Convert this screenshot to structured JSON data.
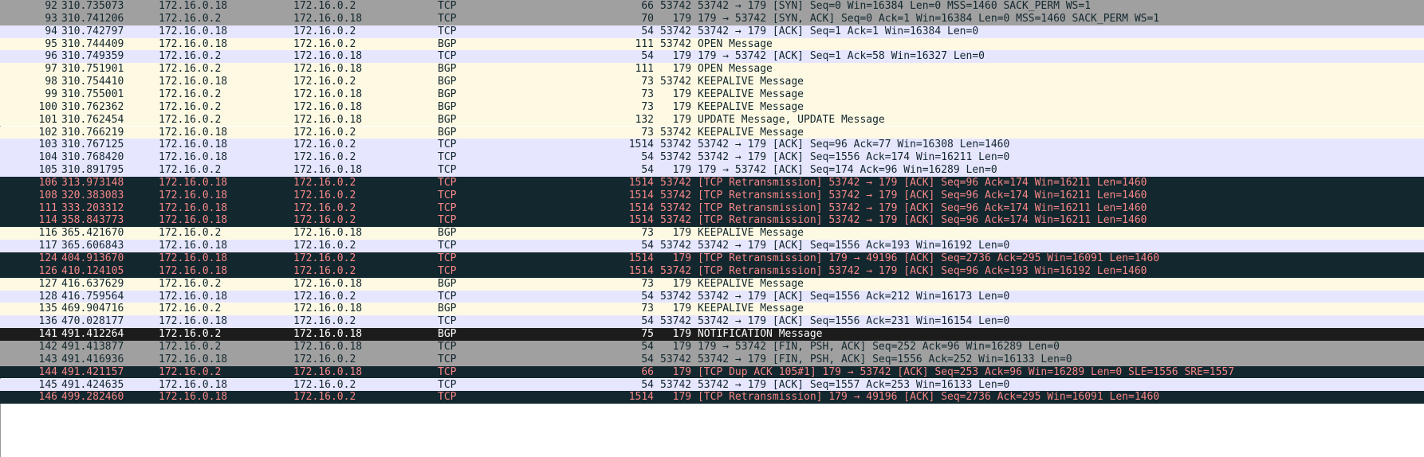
{
  "theme": {
    "tcp_bg": "#e7e6ff",
    "bgp_bg": "#fef9e3",
    "grey_bg": "#a0a0a0",
    "bad_bg": "#12272e",
    "bad_fg": "#f78787",
    "err_bg": "#1c1c1c",
    "err_fg": "#ffffff",
    "text_fg": "#12272e"
  },
  "packets": [
    {
      "no": "92",
      "time": "310.735073",
      "src": "172.16.0.18",
      "dst": "172.16.0.2",
      "proto": "TCP",
      "len": "66",
      "info": "53742 53742 → 179 [SYN] Seq=0 Win=16384 Len=0 MSS=1460 SACK_PERM WS=1",
      "style": "grey"
    },
    {
      "no": "93",
      "time": "310.741206",
      "src": "172.16.0.2",
      "dst": "172.16.0.18",
      "proto": "TCP",
      "len": "70",
      "info": "  179 179 → 53742 [SYN, ACK] Seq=0 Ack=1 Win=16384 Len=0 MSS=1460 SACK_PERM WS=1",
      "style": "grey"
    },
    {
      "no": "94",
      "time": "310.742797",
      "src": "172.16.0.18",
      "dst": "172.16.0.2",
      "proto": "TCP",
      "len": "54",
      "info": "53742 53742 → 179 [ACK] Seq=1 Ack=1 Win=16384 Len=0",
      "style": "tcp"
    },
    {
      "no": "95",
      "time": "310.744409",
      "src": "172.16.0.18",
      "dst": "172.16.0.2",
      "proto": "BGP",
      "len": "111",
      "info": "53742 OPEN Message",
      "style": "bgp"
    },
    {
      "no": "96",
      "time": "310.749359",
      "src": "172.16.0.2",
      "dst": "172.16.0.18",
      "proto": "TCP",
      "len": "54",
      "info": "  179 179 → 53742 [ACK] Seq=1 Ack=58 Win=16327 Len=0",
      "style": "tcp"
    },
    {
      "no": "97",
      "time": "310.751901",
      "src": "172.16.0.2",
      "dst": "172.16.0.18",
      "proto": "BGP",
      "len": "111",
      "info": "  179 OPEN Message",
      "style": "bgp"
    },
    {
      "no": "98",
      "time": "310.754410",
      "src": "172.16.0.18",
      "dst": "172.16.0.2",
      "proto": "BGP",
      "len": "73",
      "info": "53742 KEEPALIVE Message",
      "style": "bgp"
    },
    {
      "no": "99",
      "time": "310.755001",
      "src": "172.16.0.2",
      "dst": "172.16.0.18",
      "proto": "BGP",
      "len": "73",
      "info": "  179 KEEPALIVE Message",
      "style": "bgp"
    },
    {
      "no": "100",
      "time": "310.762362",
      "src": "172.16.0.2",
      "dst": "172.16.0.18",
      "proto": "BGP",
      "len": "73",
      "info": "  179 KEEPALIVE Message",
      "style": "bgp"
    },
    {
      "no": "101",
      "time": "310.762454",
      "src": "172.16.0.2",
      "dst": "172.16.0.18",
      "proto": "BGP",
      "len": "132",
      "info": "  179 UPDATE Message, UPDATE Message",
      "style": "bgp"
    },
    {
      "no": "102",
      "time": "310.766219",
      "src": "172.16.0.18",
      "dst": "172.16.0.2",
      "proto": "BGP",
      "len": "73",
      "info": "53742 KEEPALIVE Message",
      "style": "bgp"
    },
    {
      "no": "103",
      "time": "310.767125",
      "src": "172.16.0.18",
      "dst": "172.16.0.2",
      "proto": "TCP",
      "len": "1514",
      "info": "53742 53742 → 179 [ACK] Seq=96 Ack=77 Win=16308 Len=1460",
      "style": "tcp"
    },
    {
      "no": "104",
      "time": "310.768420",
      "src": "172.16.0.18",
      "dst": "172.16.0.2",
      "proto": "TCP",
      "len": "54",
      "info": "53742 53742 → 179 [ACK] Seq=1556 Ack=174 Win=16211 Len=0",
      "style": "tcp"
    },
    {
      "no": "105",
      "time": "310.891795",
      "src": "172.16.0.2",
      "dst": "172.16.0.18",
      "proto": "TCP",
      "len": "54",
      "info": "  179 179 → 53742 [ACK] Seq=174 Ack=96 Win=16289 Len=0",
      "style": "tcp"
    },
    {
      "no": "106",
      "time": "313.973148",
      "src": "172.16.0.18",
      "dst": "172.16.0.2",
      "proto": "TCP",
      "len": "1514",
      "info": "53742 [TCP Retransmission] 53742 → 179 [ACK] Seq=96 Ack=174 Win=16211 Len=1460",
      "style": "bad"
    },
    {
      "no": "108",
      "time": "320.383083",
      "src": "172.16.0.18",
      "dst": "172.16.0.2",
      "proto": "TCP",
      "len": "1514",
      "info": "53742 [TCP Retransmission] 53742 → 179 [ACK] Seq=96 Ack=174 Win=16211 Len=1460",
      "style": "bad"
    },
    {
      "no": "111",
      "time": "333.203312",
      "src": "172.16.0.18",
      "dst": "172.16.0.2",
      "proto": "TCP",
      "len": "1514",
      "info": "53742 [TCP Retransmission] 53742 → 179 [ACK] Seq=96 Ack=174 Win=16211 Len=1460",
      "style": "bad"
    },
    {
      "no": "114",
      "time": "358.843773",
      "src": "172.16.0.18",
      "dst": "172.16.0.2",
      "proto": "TCP",
      "len": "1514",
      "info": "53742 [TCP Retransmission] 53742 → 179 [ACK] Seq=96 Ack=174 Win=16211 Len=1460",
      "style": "bad"
    },
    {
      "no": "116",
      "time": "365.421670",
      "src": "172.16.0.2",
      "dst": "172.16.0.18",
      "proto": "BGP",
      "len": "73",
      "info": "  179 KEEPALIVE Message",
      "style": "bgp"
    },
    {
      "no": "117",
      "time": "365.606843",
      "src": "172.16.0.18",
      "dst": "172.16.0.2",
      "proto": "TCP",
      "len": "54",
      "info": "53742 53742 → 179 [ACK] Seq=1556 Ack=193 Win=16192 Len=0",
      "style": "tcp"
    },
    {
      "no": "124",
      "time": "404.913670",
      "src": "172.16.0.18",
      "dst": "172.16.0.2",
      "proto": "TCP",
      "len": "1514",
      "info": "  179 [TCP Retransmission] 179 → 49196 [ACK] Seq=2736 Ack=295 Win=16091 Len=1460",
      "style": "bad"
    },
    {
      "no": "126",
      "time": "410.124105",
      "src": "172.16.0.18",
      "dst": "172.16.0.2",
      "proto": "TCP",
      "len": "1514",
      "info": "53742 [TCP Retransmission] 53742 → 179 [ACK] Seq=96 Ack=193 Win=16192 Len=1460",
      "style": "bad"
    },
    {
      "no": "127",
      "time": "416.637629",
      "src": "172.16.0.2",
      "dst": "172.16.0.18",
      "proto": "BGP",
      "len": "73",
      "info": "  179 KEEPALIVE Message",
      "style": "bgp"
    },
    {
      "no": "128",
      "time": "416.759564",
      "src": "172.16.0.18",
      "dst": "172.16.0.2",
      "proto": "TCP",
      "len": "54",
      "info": "53742 53742 → 179 [ACK] Seq=1556 Ack=212 Win=16173 Len=0",
      "style": "tcp"
    },
    {
      "no": "135",
      "time": "469.904716",
      "src": "172.16.0.2",
      "dst": "172.16.0.18",
      "proto": "BGP",
      "len": "73",
      "info": "  179 KEEPALIVE Message",
      "style": "bgp"
    },
    {
      "no": "136",
      "time": "470.028177",
      "src": "172.16.0.18",
      "dst": "172.16.0.2",
      "proto": "TCP",
      "len": "54",
      "info": "53742 53742 → 179 [ACK] Seq=1556 Ack=231 Win=16154 Len=0",
      "style": "tcp"
    },
    {
      "no": "141",
      "time": "491.412264",
      "src": "172.16.0.2",
      "dst": "172.16.0.18",
      "proto": "BGP",
      "len": "75",
      "info": "  179 NOTIFICATION Message",
      "style": "err"
    },
    {
      "no": "142",
      "time": "491.413877",
      "src": "172.16.0.2",
      "dst": "172.16.0.18",
      "proto": "TCP",
      "len": "54",
      "info": "  179 179 → 53742 [FIN, PSH, ACK] Seq=252 Ack=96 Win=16289 Len=0",
      "style": "grey"
    },
    {
      "no": "143",
      "time": "491.416936",
      "src": "172.16.0.18",
      "dst": "172.16.0.2",
      "proto": "TCP",
      "len": "54",
      "info": "53742 53742 → 179 [FIN, PSH, ACK] Seq=1556 Ack=252 Win=16133 Len=0",
      "style": "grey"
    },
    {
      "no": "144",
      "time": "491.421157",
      "src": "172.16.0.2",
      "dst": "172.16.0.18",
      "proto": "TCP",
      "len": "66",
      "info": "  179 [TCP Dup ACK 105#1] 179 → 53742 [ACK] Seq=253 Ack=96 Win=16289 Len=0 SLE=1556 SRE=1557",
      "style": "bad"
    },
    {
      "no": "145",
      "time": "491.424635",
      "src": "172.16.0.18",
      "dst": "172.16.0.2",
      "proto": "TCP",
      "len": "54",
      "info": "53742 53742 → 179 [ACK] Seq=1557 Ack=253 Win=16133 Len=0",
      "style": "tcp"
    },
    {
      "no": "146",
      "time": "499.282460",
      "src": "172.16.0.18",
      "dst": "172.16.0.2",
      "proto": "TCP",
      "len": "1514",
      "info": "  179 [TCP Retransmission] 179 → 49196 [ACK] Seq=2736 Ack=295 Win=16091 Len=1460",
      "style": "bad"
    }
  ]
}
